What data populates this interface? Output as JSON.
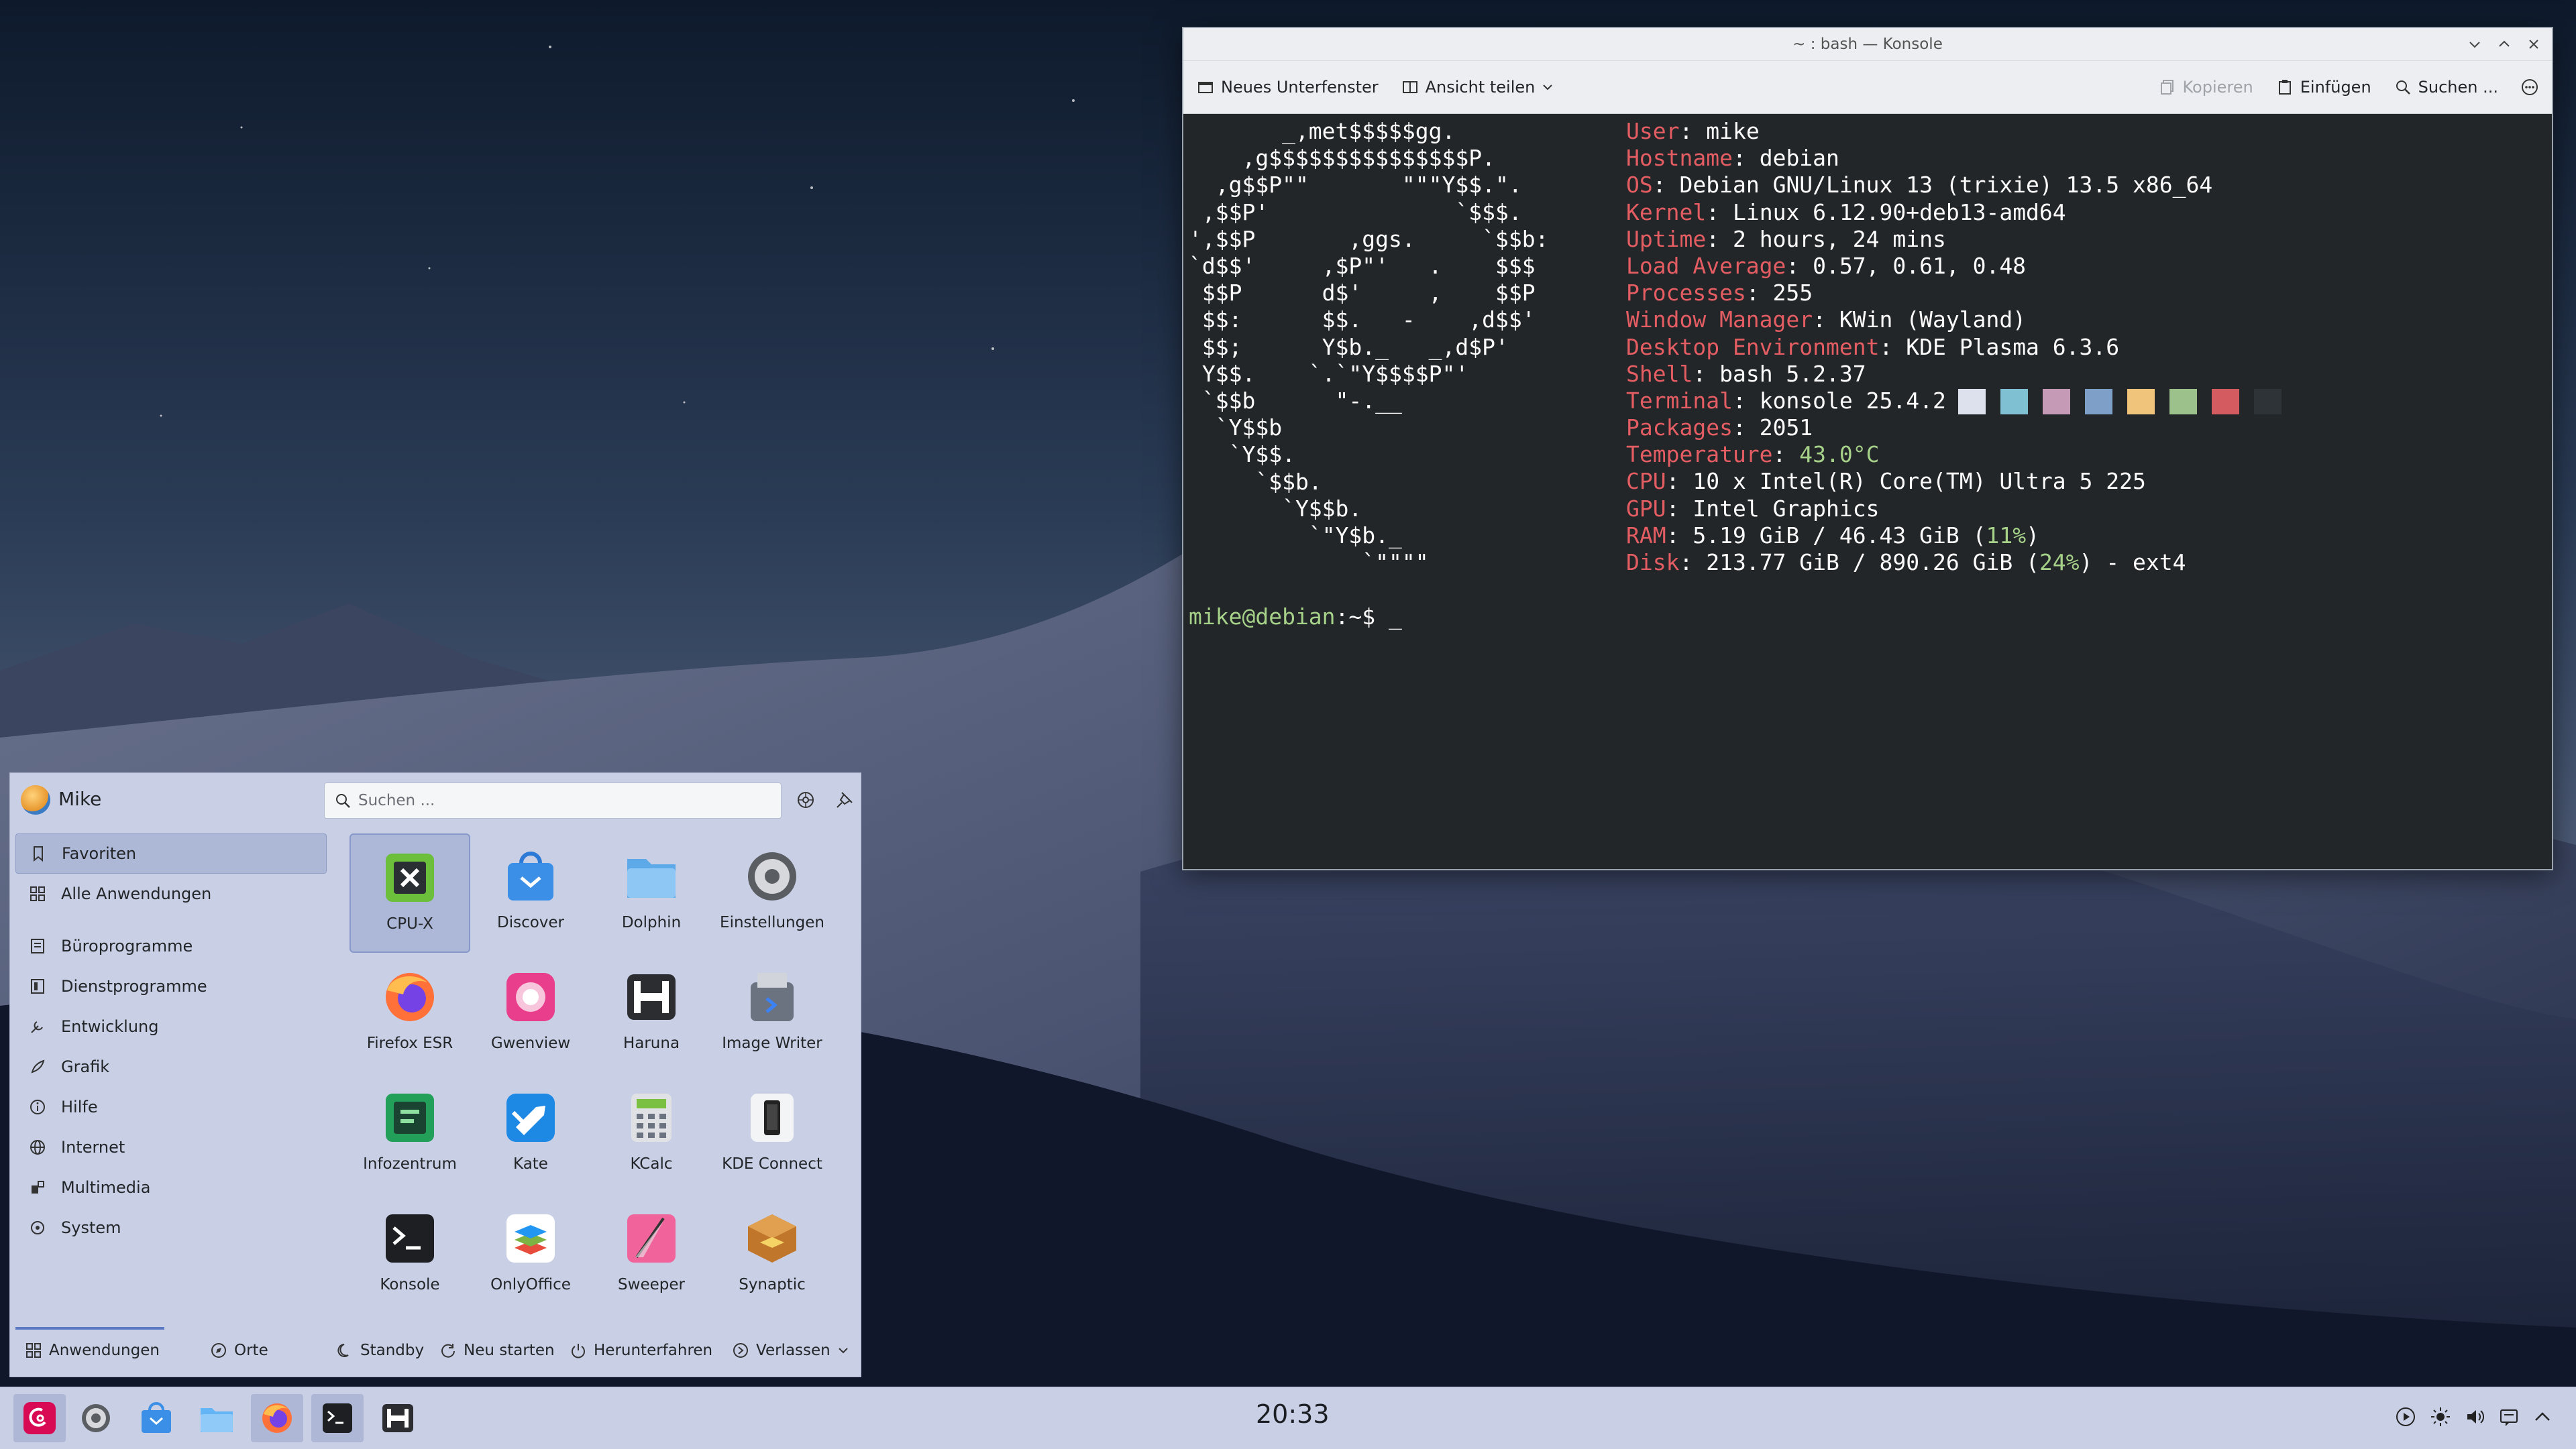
{
  "konsole": {
    "title": "~ : bash — Konsole",
    "toolbar": {
      "new_tab": "Neues Unterfenster",
      "split_view": "Ansicht teilen",
      "copy": "Kopieren",
      "paste": "Einfügen",
      "search": "Suchen ..."
    },
    "fastfetch": {
      "logo_lines": [
        "       _,met$$$$$gg.",
        "    ,g$$$$$$$$$$$$$$$P.",
        "  ,g$$P\"\"       \"\"\"Y$$.\".",
        " ,$$P'              `$$$.",
        "',$$P       ,ggs.     `$$b:",
        "`d$$'     ,$P\"'   .    $$$",
        " $$P      d$'     ,    $$P",
        " $$:      $$.   -    ,d$$'",
        " $$;      Y$b._   _,d$P'",
        " Y$$.    `.`\"Y$$$$P\"'",
        " `$$b      \"-.__",
        "  `Y$$b",
        "   `Y$$.",
        "     `$$b.",
        "       `Y$$b.",
        "         `\"Y$b._",
        "             `\"\"\"\""
      ],
      "info": [
        {
          "key": "User",
          "value": "mike"
        },
        {
          "key": "Hostname",
          "value": "debian"
        },
        {
          "key": "OS",
          "value": "Debian GNU/Linux 13 (trixie) 13.5 x86_64"
        },
        {
          "key": "Kernel",
          "value": "Linux 6.12.90+deb13-amd64"
        },
        {
          "key": "Uptime",
          "value": "2 hours, 24 mins"
        },
        {
          "key": "Load Average",
          "value": "0.57, 0.61, 0.48"
        },
        {
          "key": "Processes",
          "value": "255"
        },
        {
          "key": "Window Manager",
          "value": "KWin (Wayland)"
        },
        {
          "key": "Desktop Environment",
          "value": "KDE Plasma 6.3.6"
        },
        {
          "key": "Shell",
          "value": "bash 5.2.37"
        },
        {
          "key": "Terminal",
          "value": "konsole 25.4.2"
        },
        {
          "key": "Packages",
          "value": "2051"
        },
        {
          "key": "Temperature",
          "value": "43.0°C"
        },
        {
          "key": "CPU",
          "value": "10 x Intel(R) Core(TM) Ultra 5 225"
        },
        {
          "key": "GPU",
          "value": "Intel Graphics"
        },
        {
          "key": "RAM",
          "value_pre": "5.19 GiB / 46.43 GiB (",
          "value_pct": "11%",
          "value_post": ")"
        },
        {
          "key": "Disk",
          "value_pre": "213.77 GiB / 890.26 GiB (",
          "value_pct": "24%",
          "value_post": ") - ext4"
        }
      ],
      "palette": [
        "#dde1ee",
        "#7fc1d3",
        "#c59ab6",
        "#7d9fc8",
        "#f0c47a",
        "#9cc18a",
        "#d45c61",
        "#2e3338"
      ]
    },
    "prompt": {
      "user_host": "mike@debian",
      "path_symbol": ":~$",
      "cursor": "_"
    }
  },
  "menu": {
    "user": "Mike",
    "search_placeholder": "Suchen ...",
    "sidebar": [
      "Favoriten",
      "Alle Anwendungen",
      "Büroprogramme",
      "Dienstprogramme",
      "Entwicklung",
      "Grafik",
      "Hilfe",
      "Internet",
      "Multimedia",
      "System"
    ],
    "apps": [
      "CPU-X",
      "Discover",
      "Dolphin",
      "Einstellungen",
      "Firefox ESR",
      "Gwenview",
      "Haruna",
      "Image Writer",
      "Infozentrum",
      "Kate",
      "KCalc",
      "KDE Connect",
      "Konsole",
      "OnlyOffice",
      "Sweeper",
      "Synaptic"
    ],
    "footer": {
      "applications": "Anwendungen",
      "places": "Orte",
      "standby": "Standby",
      "restart": "Neu starten",
      "shutdown": "Herunterfahren",
      "leave": "Verlassen"
    }
  },
  "panel": {
    "clock": "20:33"
  },
  "colors": {
    "terminal_bg": "#232629",
    "key_red": "#e35d63",
    "green": "#a6d189",
    "menu_bg": "#c9d0e6",
    "accent": "#5d7ac4"
  }
}
